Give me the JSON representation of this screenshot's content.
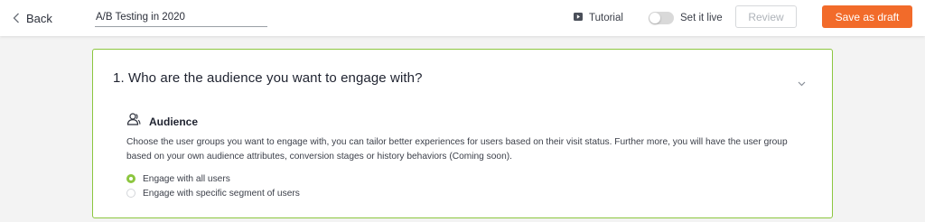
{
  "header": {
    "back_label": "Back",
    "name_value": "A/B Testing in 2020",
    "tutorial_label": "Tutorial",
    "set_live_label": "Set it live",
    "set_live_on": false,
    "review_label": "Review",
    "save_draft_label": "Save as draft"
  },
  "step": {
    "title": "1. Who are the audience you want to engage with?",
    "section_title": "Audience",
    "section_icon": "audience-icon",
    "description": "Choose the user groups you want to engage with, you can tailor better experiences for users based on their visit status. Further more, you will have the user group based on your own audience attributes, conversion stages or history behaviors (Coming soon).",
    "options": [
      {
        "label": "Engage with all users",
        "selected": true
      },
      {
        "label": "Engage with specific segment of users",
        "selected": false
      }
    ]
  },
  "colors": {
    "accent_green": "#8cc63f",
    "primary_orange": "#f26b2a",
    "page_background": "#f3f3f3"
  }
}
